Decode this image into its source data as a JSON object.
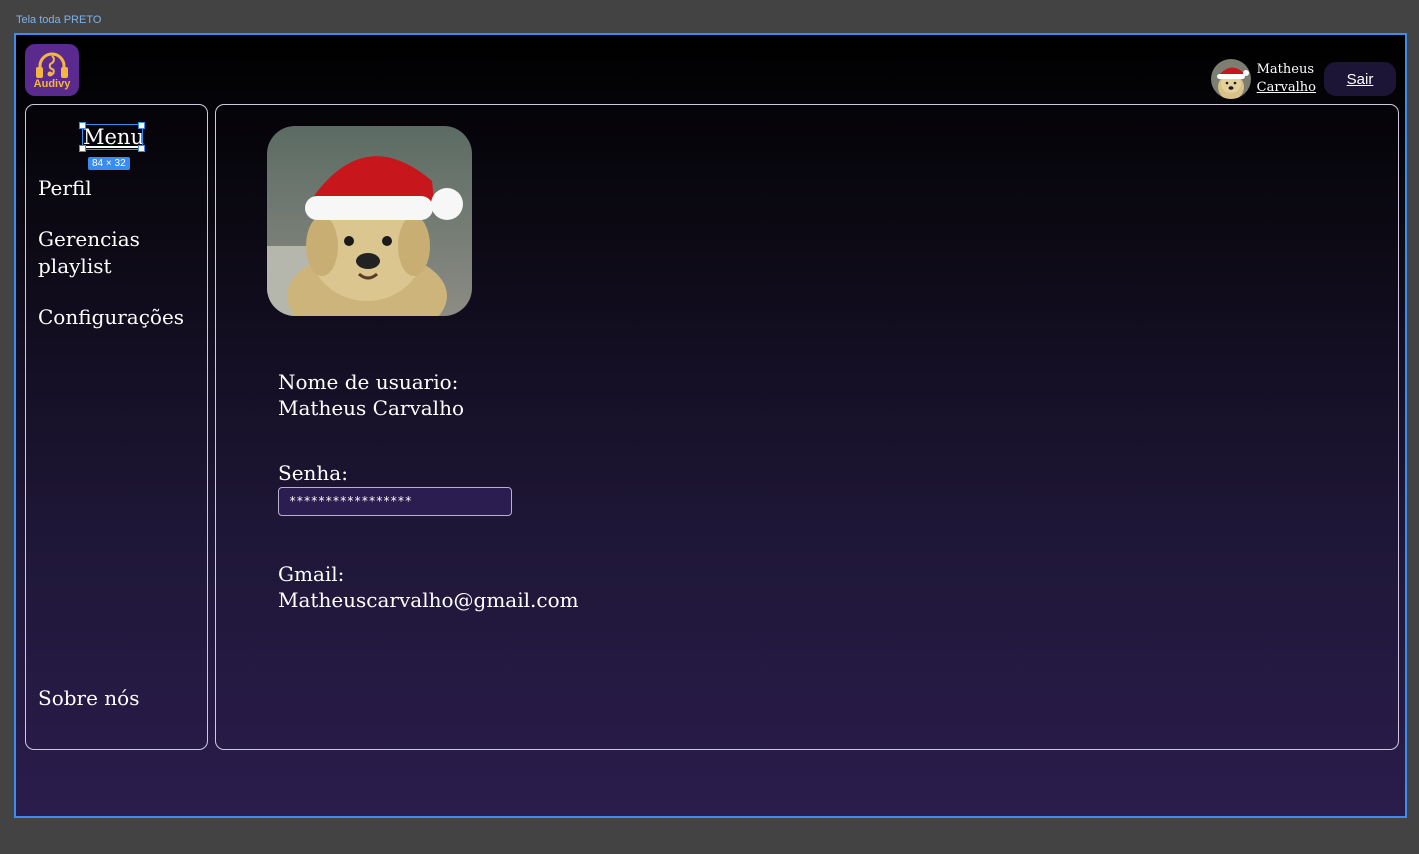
{
  "canvas": {
    "frame_label": "Tela toda PRETO"
  },
  "header": {
    "logo_text": "Audivy",
    "user_first_name": "Matheus",
    "user_last_name": "Carvalho",
    "logout_label": "Sair"
  },
  "sidebar": {
    "title": "Menu",
    "selection_size_badge": "84 × 32",
    "items": [
      {
        "label": "Perfil"
      },
      {
        "label": "Gerencias playlist"
      },
      {
        "label": "Configurações"
      }
    ],
    "footer_item": "Sobre nós"
  },
  "profile": {
    "username_label": "Nome de usuario:",
    "username_value": "Matheus Carvalho",
    "password_label": "Senha:",
    "password_value": "*****************",
    "email_label": "Gmail:",
    "email_value": "Matheuscarvalho@gmail.com"
  },
  "colors": {
    "background_top": "#000000",
    "background_bottom": "#2a1c4c",
    "logo_bg": "#5b2a8e",
    "logo_accent": "#f5b544",
    "selection_blue": "#3a8cf0",
    "button_bg": "#1c1536",
    "input_bg": "#2b1d4f"
  },
  "icons": {
    "logo": "headphones-music-note-icon",
    "avatar": "puppy-santa-hat-photo"
  }
}
